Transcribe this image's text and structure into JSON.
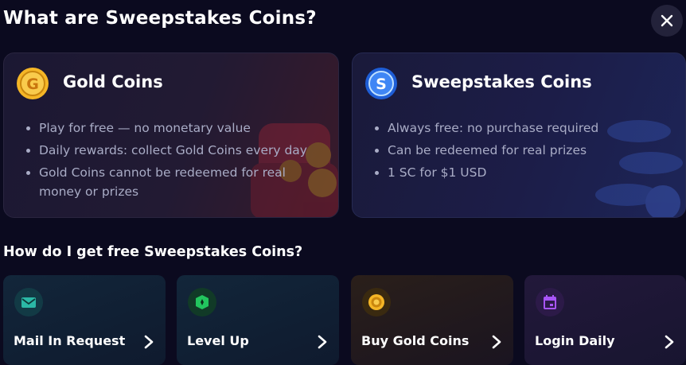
{
  "modal": {
    "title": "What are Sweepstakes Coins?",
    "close_icon": "close-icon"
  },
  "cards": [
    {
      "title": "Gold Coins",
      "icon": "gold-coin-icon",
      "accent": "#f5b626",
      "bullets": [
        "Play for free — no monetary value",
        "Daily rewards: collect Gold Coins every day",
        "Gold Coins cannot be redeemed for real money or prizes"
      ]
    },
    {
      "title": "Sweepstakes Coins",
      "icon": "sweepstakes-coin-icon",
      "accent": "#2f7ef0",
      "bullets": [
        "Always free: no purchase required",
        "Can be redeemed for real prizes",
        "1 SC for $1 USD"
      ]
    }
  ],
  "how_to": {
    "title": "How do I get free Sweepstakes Coins?",
    "actions": [
      {
        "label": "Mail In Request",
        "icon": "mail-icon",
        "color": "#2bb8a6"
      },
      {
        "label": "Level Up",
        "icon": "level-badge-icon",
        "color": "#22c55e"
      },
      {
        "label": "Buy Gold Coins",
        "icon": "gold-coin-icon",
        "color": "#f5b626"
      },
      {
        "label": "Login Daily",
        "icon": "calendar-icon",
        "color": "#a855f7"
      }
    ]
  }
}
